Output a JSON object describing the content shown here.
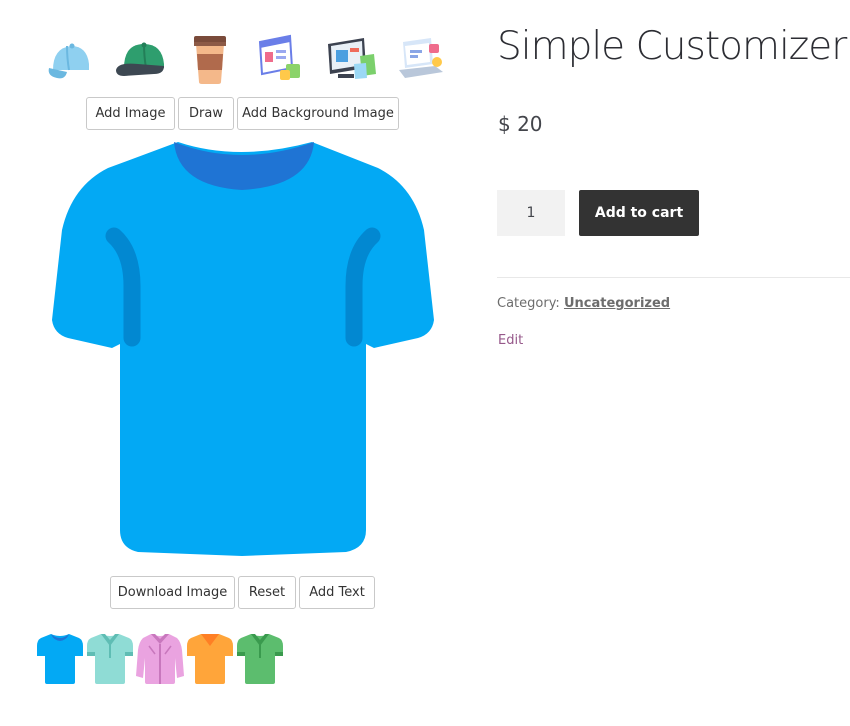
{
  "product": {
    "title": "Simple Customizer",
    "price": "$ 20",
    "quantity": "1",
    "add_to_cart_label": "Add to cart",
    "category_label": "Category:",
    "category_value": "Uncategorized",
    "edit_label": "Edit"
  },
  "customizer": {
    "clipart": [
      {
        "icon": "light-blue-cap-icon"
      },
      {
        "icon": "green-cap-icon"
      },
      {
        "icon": "coffee-cup-icon"
      },
      {
        "icon": "web-design-icon"
      },
      {
        "icon": "online-shopping-icon"
      },
      {
        "icon": "laptop-shopping-icon"
      }
    ],
    "top_tools": [
      "Add Image",
      "Draw",
      "Add Background Image"
    ],
    "bottom_tools": [
      "Download Image",
      "Reset",
      "Add Text"
    ],
    "shirt_color": "#03a9f4",
    "swatches": [
      {
        "icon": "blue-tshirt-icon",
        "color": "#03a9f4"
      },
      {
        "icon": "mint-polo-icon",
        "color": "#8fdcd5"
      },
      {
        "icon": "pink-shirt-icon",
        "color": "#eaa3e0"
      },
      {
        "icon": "orange-tshirt-icon",
        "color": "#ffa53a"
      },
      {
        "icon": "green-polo-icon",
        "color": "#5cbd6e"
      }
    ]
  }
}
